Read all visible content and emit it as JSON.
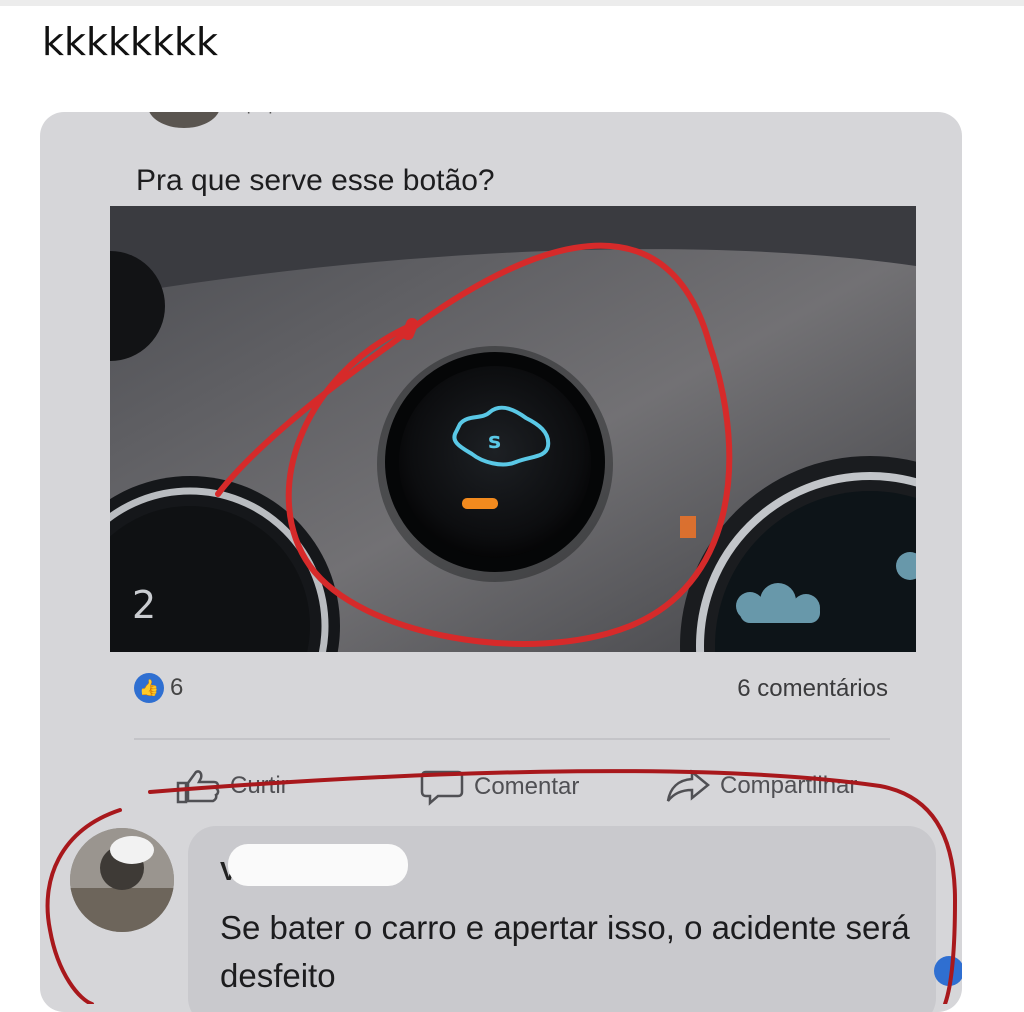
{
  "caption": "kkkkkkkk",
  "post": {
    "text": "Pra que serve esse botão?",
    "reaction_count": "6",
    "comments_label": "6 comentários"
  },
  "actions": {
    "like": "Curtir",
    "comment": "Comentar",
    "share": "Compartilhar"
  },
  "comment": {
    "author": "Vitor",
    "text": "Se bater o carro e apertar isso, o acidente será desfeito"
  },
  "photo": {
    "gauge_number": "2"
  },
  "colors": {
    "card": "#d6d6d9",
    "like_blue": "#2f6fd1",
    "annotation_red": "#d62a2a",
    "button_icon": "#5ac8e6",
    "indicator_orange": "#f28a1e"
  }
}
